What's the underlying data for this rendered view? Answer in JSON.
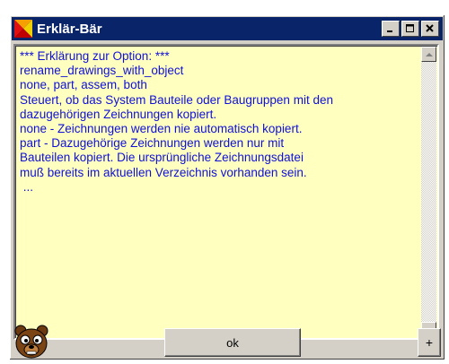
{
  "window": {
    "title": "Erklär-Bär",
    "minimize_label": "_",
    "maximize_label": "□",
    "close_label": "×"
  },
  "help_text": {
    "lines": [
      "*** Erklärung zur Option: ***",
      "rename_drawings_with_object",
      "none, part, assem, both",
      "Steuert, ob das System Bauteile oder Baugruppen mit den",
      "dazugehörigen Zeichnungen kopiert.",
      "none - Zeichnungen werden nie automatisch kopiert.",
      "part - Dazugehörige Zeichnungen werden nur mit",
      "Bauteilen kopiert. Die ursprüngliche Zeichnungsdatei",
      "muß bereits im aktuellen Verzeichnis vorhanden sein.",
      " ..."
    ]
  },
  "buttons": {
    "ok_label": "ok",
    "plus_label": "+"
  },
  "colors": {
    "text": "#1010d8",
    "text_bg": "#ffffc0",
    "titlebar": "#0a246a"
  },
  "icons": {
    "title": "app-logo-icon",
    "bear": "bear-mascot-icon"
  }
}
